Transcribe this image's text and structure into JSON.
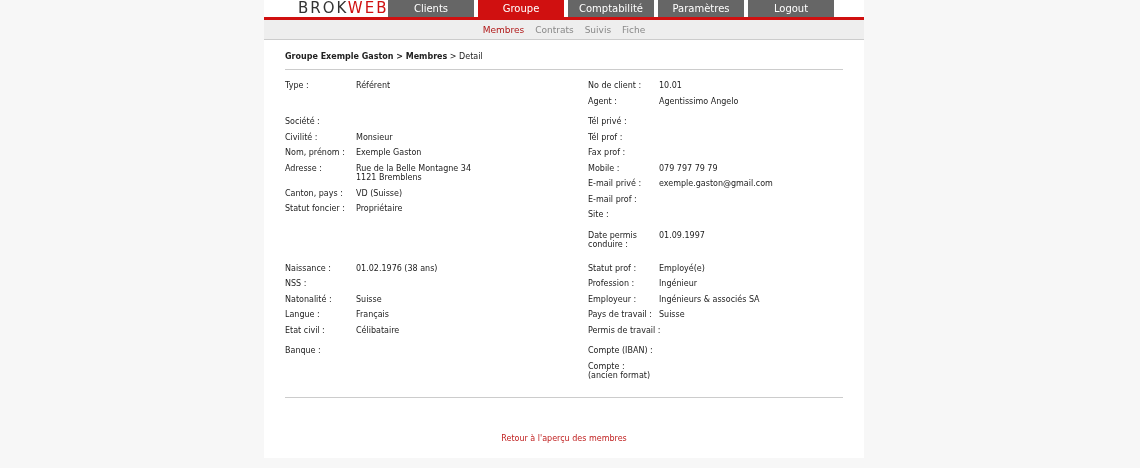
{
  "logo": {
    "dark": "BROK",
    "accent": "WEB"
  },
  "tabs": [
    {
      "label": "Clients",
      "selected": false
    },
    {
      "label": "Groupe",
      "selected": true
    },
    {
      "label": "Comptabilité",
      "selected": false
    },
    {
      "label": "Paramètres",
      "selected": false
    },
    {
      "label": "Logout",
      "selected": false
    }
  ],
  "subtabs": [
    {
      "label": "Membres",
      "selected": true
    },
    {
      "label": "Contrats",
      "selected": false
    },
    {
      "label": "Suivis",
      "selected": false
    },
    {
      "label": "Fiche",
      "selected": false
    }
  ],
  "breadcrumb": "**Groupe Exemple Gaston > Membres** > Detail",
  "sections": [
    [
      {
        "left": [
          {
            "label": "Type :",
            "value": [
              "Référent"
            ]
          }
        ],
        "right": [
          {
            "label": "No de client :",
            "value": [
              "10.01"
            ]
          },
          {
            "label": "Agent :",
            "value": [
              "Agentissimo Angelo"
            ]
          }
        ]
      },
      {
        "left": [
          {
            "label": "Société :"
          },
          {
            "label": "Civilité :",
            "value": [
              "Monsieur"
            ]
          },
          {
            "label": "Nom, prénom :",
            "value": [
              "Exemple Gaston"
            ]
          },
          {
            "label": "Adresse :",
            "value": [
              "Rue de la Belle Montagne 34",
              "1121 Bremblens"
            ]
          },
          {
            "label": "Canton, pays :",
            "value": [
              "VD (Suisse)"
            ]
          },
          {
            "label": "Statut foncier :",
            "value": [
              "Propriétaire"
            ]
          }
        ],
        "right": [
          {
            "label": "Tél privé :"
          },
          {
            "label": "Tél prof :"
          },
          {
            "label": "Fax prof :"
          },
          {
            "label": "Mobile :",
            "value": [
              "079 797 79 79"
            ]
          },
          {
            "label": "E-mail privé :",
            "value": [
              "exemple.gaston@gmail.com"
            ]
          },
          {
            "label": "E-mail prof :"
          },
          {
            "label": "Site :"
          }
        ]
      },
      {
        "right": [
          {
            "label": "Date permis\nconduire :",
            "value": [
              "01.09.1997"
            ]
          }
        ]
      }
    ],
    [
      {
        "left": [
          {
            "label": "Naissance :",
            "value": [
              "01.02.1976 (38 ans)"
            ]
          },
          {
            "label": "NSS :"
          },
          {
            "label": "Natonalité :",
            "value": [
              "Suisse"
            ]
          },
          {
            "label": "Langue :",
            "value": [
              "Français"
            ]
          },
          {
            "label": "Etat civil :",
            "value": [
              "Célibataire"
            ]
          }
        ],
        "right": [
          {
            "label": "Statut prof :",
            "value": [
              "Employé(e)"
            ]
          },
          {
            "label": "Profession :",
            "value": [
              "Ingénieur"
            ]
          },
          {
            "label": "Employeur :",
            "value": [
              "Ingénieurs & associés SA"
            ]
          },
          {
            "label": "Pays de travail :",
            "value": [
              "Suisse"
            ]
          },
          {
            "label": "Permis de travail :"
          }
        ]
      },
      {
        "left": [
          {
            "label": "Banque :"
          }
        ],
        "right": [
          {
            "label": "Compte (IBAN) :"
          },
          {
            "label": "Compte :\n(ancien format)"
          }
        ]
      }
    ]
  ],
  "back_link": "Retour à l'aperçu des membres"
}
